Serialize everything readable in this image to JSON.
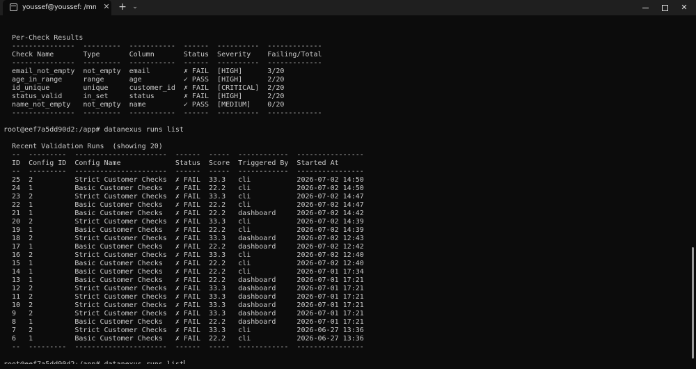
{
  "titlebar": {
    "tab_title": "youssef@youssef: /mnt/c/use",
    "close_glyph": "✕",
    "new_tab_glyph": "+",
    "dropdown_glyph": "⌄",
    "close_window_glyph": "✕"
  },
  "terminal": {
    "lines": [
      "",
      "  Per-Check Results",
      "  ---------------  ---------  -----------  ------  ----------  -------------",
      "  Check Name       Type       Column       Status  Severity    Failing/Total",
      "  ---------------  ---------  -----------  ------  ----------  -------------",
      "  email_not_empty  not_empty  email        ✗ FAIL  [HIGH]      3/20",
      "  age_in_range     range      age          ✓ PASS  [HIGH]      2/20",
      "  id_unique        unique     customer_id  ✗ FAIL  [CRITICAL]  2/20",
      "  status_valid     in_set     status       ✗ FAIL  [HIGH]      2/20",
      "  name_not_empty   not_empty  name         ✓ PASS  [MEDIUM]    0/20",
      "  ---------------  ---------  -----------  ------  ----------  -------------",
      "",
      "root@eef7a5dd90d2:/app# datanexus runs list",
      "",
      "  Recent Validation Runs  (showing 20)",
      "  --  ---------  ----------------------  ------  -----  ------------  ----------------",
      "  ID  Config ID  Config Name             Status  Score  Triggered By  Started At",
      "  --  ---------  ----------------------  ------  -----  ------------  ----------------",
      "  25  2          Strict Customer Checks  ✗ FAIL  33.3   cli           2026-07-02 14:50",
      "  24  1          Basic Customer Checks   ✗ FAIL  22.2   cli           2026-07-02 14:50",
      "  23  2          Strict Customer Checks  ✗ FAIL  33.3   cli           2026-07-02 14:47",
      "  22  1          Basic Customer Checks   ✗ FAIL  22.2   cli           2026-07-02 14:47",
      "  21  1          Basic Customer Checks   ✗ FAIL  22.2   dashboard     2026-07-02 14:42",
      "  20  2          Strict Customer Checks  ✗ FAIL  33.3   cli           2026-07-02 14:39",
      "  19  1          Basic Customer Checks   ✗ FAIL  22.2   cli           2026-07-02 14:39",
      "  18  2          Strict Customer Checks  ✗ FAIL  33.3   dashboard     2026-07-02 12:43",
      "  17  1          Basic Customer Checks   ✗ FAIL  22.2   dashboard     2026-07-02 12:42",
      "  16  2          Strict Customer Checks  ✗ FAIL  33.3   cli           2026-07-02 12:40",
      "  15  1          Basic Customer Checks   ✗ FAIL  22.2   cli           2026-07-02 12:40",
      "  14  1          Basic Customer Checks   ✗ FAIL  22.2   cli           2026-07-01 17:34",
      "  13  1          Basic Customer Checks   ✗ FAIL  22.2   dashboard     2026-07-01 17:21",
      "  12  2          Strict Customer Checks  ✗ FAIL  33.3   dashboard     2026-07-01 17:21",
      "  11  2          Strict Customer Checks  ✗ FAIL  33.3   dashboard     2026-07-01 17:21",
      "  10  2          Strict Customer Checks  ✗ FAIL  33.3   dashboard     2026-07-01 17:21",
      "  9   2          Strict Customer Checks  ✗ FAIL  33.3   dashboard     2026-07-01 17:21",
      "  8   1          Basic Customer Checks   ✗ FAIL  22.2   dashboard     2026-07-01 17:21",
      "  7   2          Strict Customer Checks  ✗ FAIL  33.3   cli           2026-06-27 13:36",
      "  6   1          Basic Customer Checks   ✗ FAIL  22.2   cli           2026-06-27 13:36",
      "  --  ---------  ----------------------  ------  -----  ------------  ----------------",
      ""
    ],
    "prompt": "root@eef7a5dd90d2:/app# ",
    "current_input": "datanexus runs list"
  }
}
